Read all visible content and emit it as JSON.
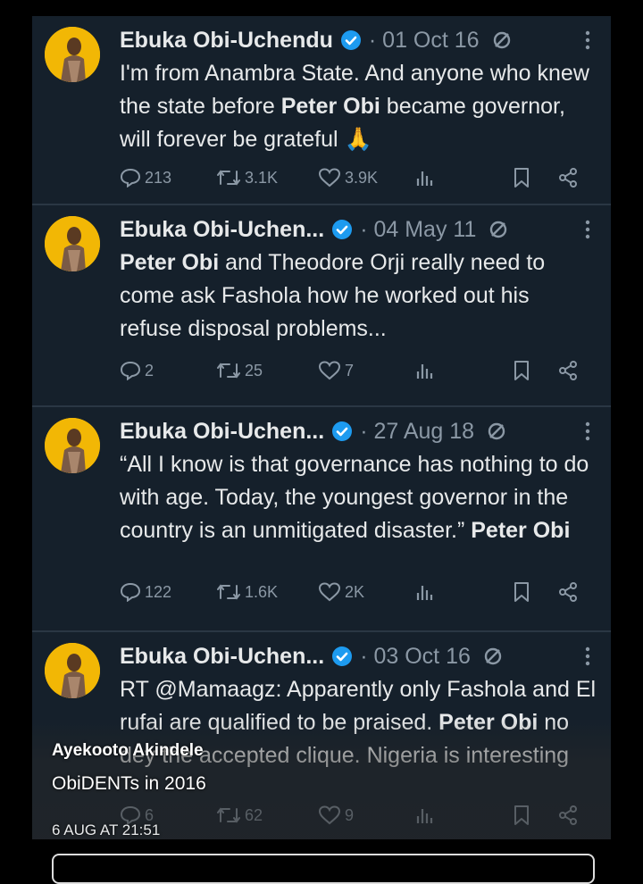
{
  "tweets": [
    {
      "name": "Ebuka Obi-Uchendu",
      "date": "· 01 Oct 16",
      "text_html": "I'm from Anambra State. And anyone who knew the state before <b>Peter Obi</b> became governor, will forever be grateful 🙏",
      "replies": "213",
      "retweets": "3.1K",
      "likes": "3.9K"
    },
    {
      "name": "Ebuka Obi-Uchen...",
      "date": "· 04 May 11",
      "text_html": "<b>Peter Obi</b> and Theodore Orji really need to come ask Fashola how he worked out his refuse disposal problems...",
      "replies": "2",
      "retweets": "25",
      "likes": "7"
    },
    {
      "name": "Ebuka Obi-Uchen...",
      "date": "· 27 Aug 18",
      "text_html": "“All I know is that governance has nothing to do with age. Today, the youngest governor in the country is an unmitigated disaster.” <b>Peter Obi</b>",
      "replies": "122",
      "retweets": "1.6K",
      "likes": "2K"
    },
    {
      "name": "Ebuka Obi-Uchen...",
      "date": "· 03 Oct 16",
      "text_html": "RT @Mamaagz: Apparently only Fashola and El rufai are qualified to be praised. <b>Peter Obi</b> no dey the accepted clique. Nigeria is interesting",
      "replies": "6",
      "retweets": "62",
      "likes": "9"
    }
  ],
  "icons": {
    "verified": "verified-badge-icon",
    "grok": "grok-icon",
    "more": "more-options-icon",
    "reply": "reply-icon",
    "retweet": "retweet-icon",
    "like": "like-icon",
    "views": "views-icon",
    "bookmark": "bookmark-icon",
    "share": "share-icon"
  },
  "colors": {
    "background": "#15202b",
    "verified": "#1d9bf0",
    "muted": "#8b98a5",
    "avatar": "#f2b705"
  },
  "caption": {
    "author": "Ayekooto Akindele",
    "group": "ObiDENTs in 2016",
    "date": "6 AUG AT 21:51"
  }
}
